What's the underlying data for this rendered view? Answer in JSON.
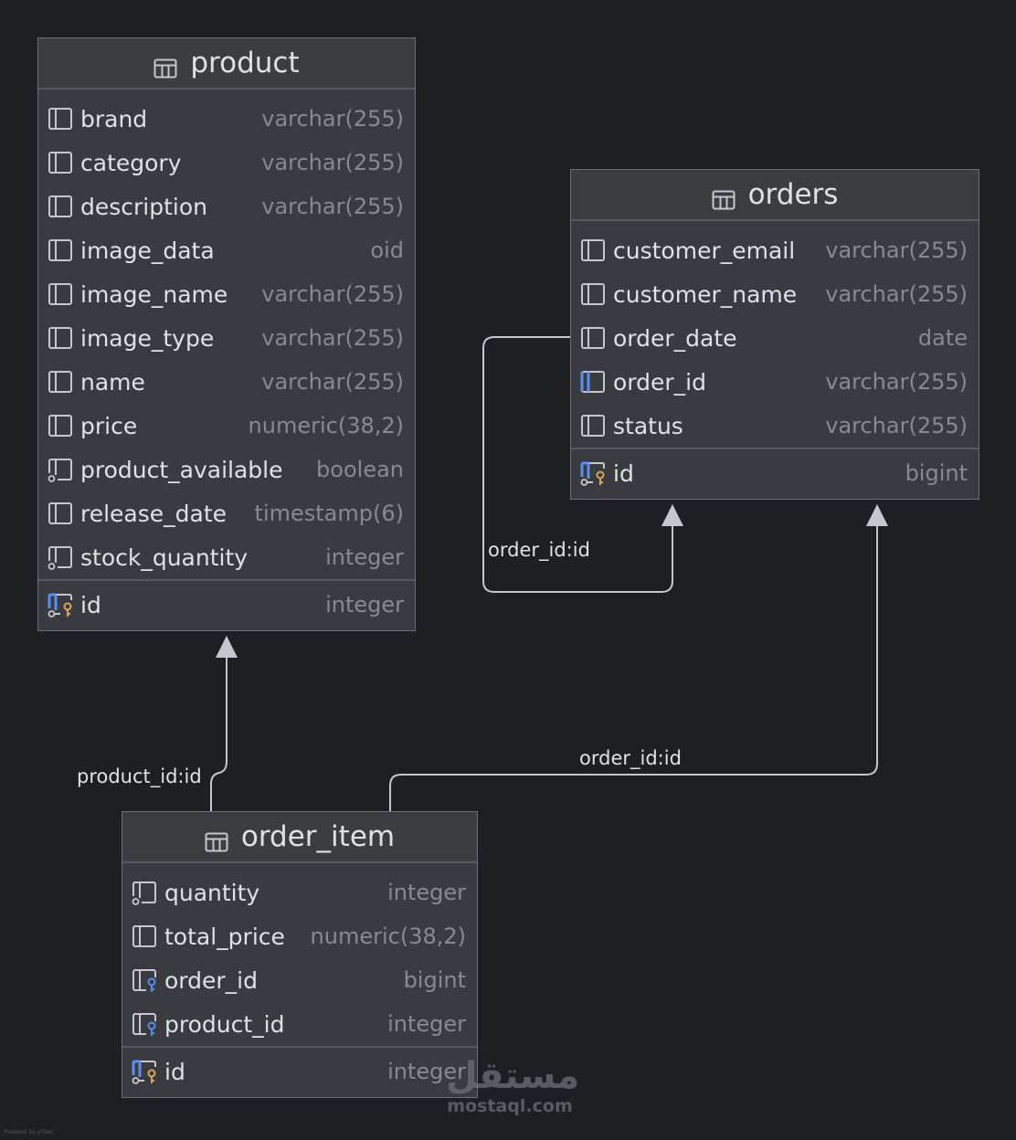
{
  "tables": {
    "product": {
      "title": "product",
      "columns": [
        {
          "name": "brand",
          "type": "varchar(255)",
          "kind": "column"
        },
        {
          "name": "category",
          "type": "varchar(255)",
          "kind": "column"
        },
        {
          "name": "description",
          "type": "varchar(255)",
          "kind": "column"
        },
        {
          "name": "image_data",
          "type": "oid",
          "kind": "column"
        },
        {
          "name": "image_name",
          "type": "varchar(255)",
          "kind": "column"
        },
        {
          "name": "image_type",
          "type": "varchar(255)",
          "kind": "column"
        },
        {
          "name": "name",
          "type": "varchar(255)",
          "kind": "column"
        },
        {
          "name": "price",
          "type": "numeric(38,2)",
          "kind": "column"
        },
        {
          "name": "product_available",
          "type": "boolean",
          "kind": "not-null-column"
        },
        {
          "name": "release_date",
          "type": "timestamp(6)",
          "kind": "column"
        },
        {
          "name": "stock_quantity",
          "type": "integer",
          "kind": "not-null-column"
        }
      ],
      "primary_key": {
        "name": "id",
        "type": "integer",
        "kind": "primary-key"
      }
    },
    "orders": {
      "title": "orders",
      "columns": [
        {
          "name": "customer_email",
          "type": "varchar(255)",
          "kind": "column"
        },
        {
          "name": "customer_name",
          "type": "varchar(255)",
          "kind": "column"
        },
        {
          "name": "order_date",
          "type": "date",
          "kind": "column"
        },
        {
          "name": "order_id",
          "type": "varchar(255)",
          "kind": "unique-column"
        },
        {
          "name": "status",
          "type": "varchar(255)",
          "kind": "column"
        }
      ],
      "primary_key": {
        "name": "id",
        "type": "bigint",
        "kind": "primary-key"
      }
    },
    "order_item": {
      "title": "order_item",
      "columns": [
        {
          "name": "quantity",
          "type": "integer",
          "kind": "not-null-column"
        },
        {
          "name": "total_price",
          "type": "numeric(38,2)",
          "kind": "column"
        },
        {
          "name": "order_id",
          "type": "bigint",
          "kind": "foreign-key"
        },
        {
          "name": "product_id",
          "type": "integer",
          "kind": "foreign-key"
        }
      ],
      "primary_key": {
        "name": "id",
        "type": "integer",
        "kind": "primary-key"
      }
    }
  },
  "relations": {
    "orders_self": {
      "label": "order_id:id",
      "from": "orders",
      "to": "orders"
    },
    "item_to_orders": {
      "label": "order_id:id",
      "from": "order_item",
      "to": "orders"
    },
    "item_to_product": {
      "label": "product_id:id",
      "from": "order_item",
      "to": "product"
    }
  },
  "watermark": {
    "logo": "مستقل",
    "url": "mostaql.com"
  },
  "footer": {
    "note": "Powered by yFiles"
  },
  "colors": {
    "background": "#1e1f22",
    "table_fill": "#393b40",
    "header_fill": "#3c3d40",
    "text": "#dfe1e5",
    "type_text": "#868a91",
    "connector": "#c5c7cc",
    "key_gold": "#d8a657",
    "key_blue": "#5a8ff0"
  }
}
